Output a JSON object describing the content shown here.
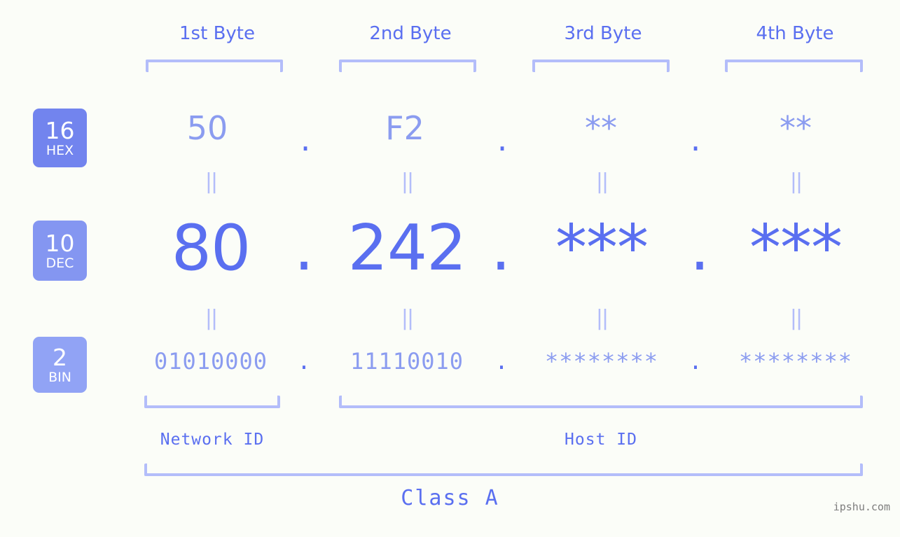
{
  "background": "#fbfdf8",
  "colors": {
    "accent_strong": "#5a6ff0",
    "accent_mid": "#8b9cf0",
    "accent_light": "#b3bdfa",
    "badge_hex": "#7284ee",
    "badge_dec": "#8496f1",
    "badge_bin": "#91a3f5",
    "watermark": "#7d7d7d"
  },
  "header": {
    "byte_labels": [
      "1st Byte",
      "2nd Byte",
      "3rd Byte",
      "4th Byte"
    ]
  },
  "bases": [
    {
      "num": "16",
      "name": "HEX"
    },
    {
      "num": "10",
      "name": "DEC"
    },
    {
      "num": "2",
      "name": "BIN"
    }
  ],
  "rows": {
    "hex": {
      "values": [
        "50",
        "F2",
        "**",
        "**"
      ],
      "separator": "."
    },
    "dec": {
      "values": [
        "80",
        "242",
        "***",
        "***"
      ],
      "separator": "."
    },
    "bin": {
      "values": [
        "01010000",
        "11110010",
        "********",
        "********"
      ],
      "separator": "."
    }
  },
  "equality_marks": {
    "hex_to_dec": [
      "||",
      "||",
      "||",
      "||"
    ],
    "dec_to_bin": [
      "||",
      "||",
      "||",
      "||"
    ]
  },
  "footer": {
    "network_id": "Network ID",
    "host_id": "Host ID",
    "class": "Class A",
    "watermark": "ipshu.com"
  }
}
